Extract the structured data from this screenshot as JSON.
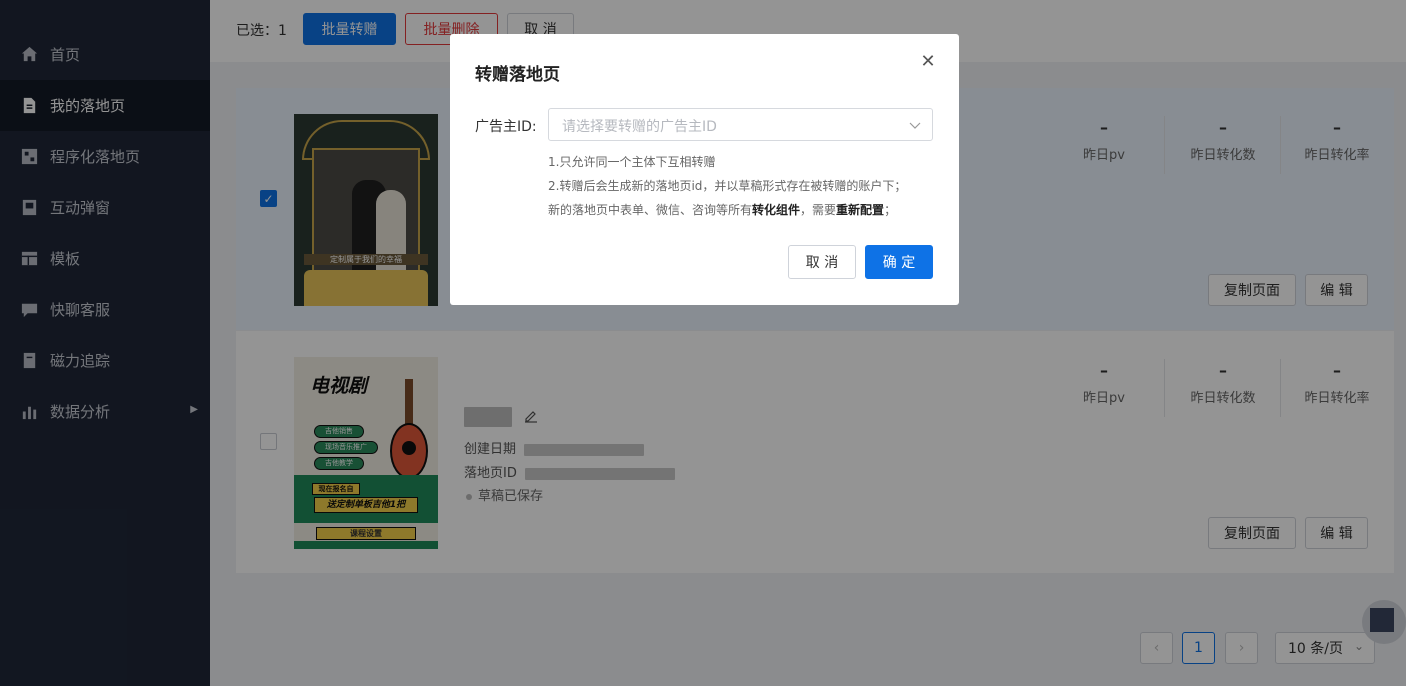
{
  "sidebar": {
    "items": [
      {
        "label": "首页",
        "icon": "home-icon"
      },
      {
        "label": "我的落地页",
        "icon": "document-icon"
      },
      {
        "label": "程序化落地页",
        "icon": "grid-page-icon"
      },
      {
        "label": "互动弹窗",
        "icon": "popup-icon"
      },
      {
        "label": "模板",
        "icon": "table-icon"
      },
      {
        "label": "快聊客服",
        "icon": "chat-icon"
      },
      {
        "label": "磁力追踪",
        "icon": "tracking-icon"
      },
      {
        "label": "数据分析",
        "icon": "bar-chart-icon"
      }
    ],
    "active_index": 1
  },
  "toolbar": {
    "selected_text": "已选：1",
    "batch_transfer": "批量转赠",
    "batch_delete": "批量删除",
    "cancel": "取 消"
  },
  "cards": [
    {
      "checked": true,
      "thumb_caption": "定制属于我们的幸福",
      "stats": [
        {
          "value": "–",
          "label": "昨日pv"
        },
        {
          "value": "–",
          "label": "昨日转化数"
        },
        {
          "value": "–",
          "label": "昨日转化率"
        }
      ],
      "copy_label": "复制页面",
      "edit_label": "编 辑"
    },
    {
      "checked": false,
      "thumb_title": "电视剧",
      "thumb_tags": [
        "吉他销售",
        "现场音乐推广",
        "吉他教学"
      ],
      "thumb_banner_small": "现在报名自",
      "thumb_banner": "送定制单板吉他1把",
      "thumb_course": "课程设置",
      "created_label": "创建日期",
      "page_id_label": "落地页ID",
      "status": "草稿已保存",
      "stats": [
        {
          "value": "–",
          "label": "昨日pv"
        },
        {
          "value": "–",
          "label": "昨日转化数"
        },
        {
          "value": "–",
          "label": "昨日转化率"
        }
      ],
      "copy_label": "复制页面",
      "edit_label": "编 辑"
    }
  ],
  "pagination": {
    "current_page": "1",
    "page_size": "10 条/页"
  },
  "modal": {
    "title": "转赠落地页",
    "field_label": "广告主ID:",
    "placeholder": "请选择要转赠的广告主ID",
    "tip1": "1.只允许同一个主体下互相转赠",
    "tip2": "2.转赠后会生成新的落地页id，并以草稿形式存在被转赠的账户下；",
    "tip3_part1": "新的落地页中表单、微信、咨询等所有",
    "tip3_bold1": "转化组件",
    "tip3_part2": "，需要",
    "tip3_bold2": "重新配置",
    "tip3_part3": "；",
    "cancel": "取 消",
    "confirm": "确 定"
  },
  "colors": {
    "primary": "#0e72e6",
    "danger": "#e4393c",
    "sidebar_bg": "#1f2738"
  }
}
